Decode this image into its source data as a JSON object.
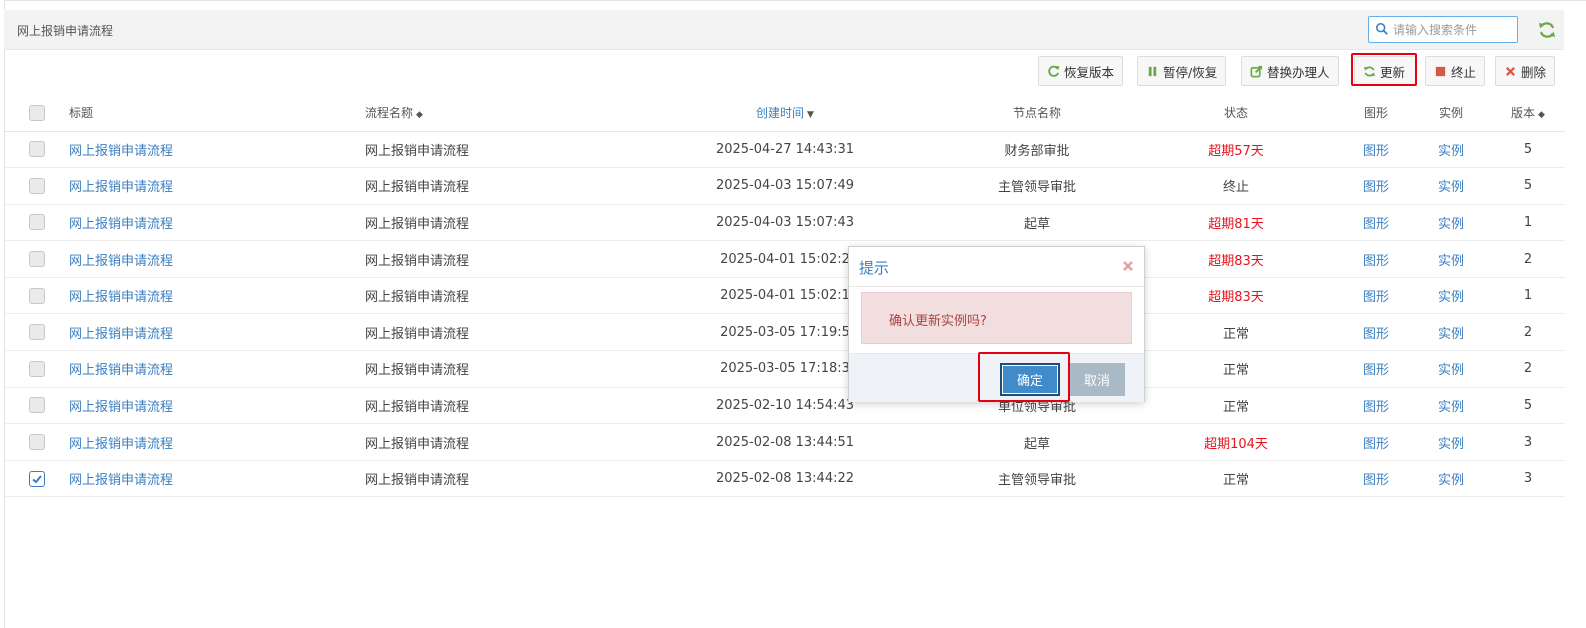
{
  "header": {
    "title": "网上报销申请流程"
  },
  "search": {
    "placeholder": "请输入搜索条件"
  },
  "toolbar": {
    "restore_label": "恢复版本",
    "pause_label": "暂停/恢复",
    "replace_label": "替换办理人",
    "update_label": "更新",
    "terminate_label": "终止",
    "delete_label": "删除"
  },
  "table": {
    "headers": {
      "title": "标题",
      "flow_name": "流程名称",
      "created": "创建时间",
      "node": "节点名称",
      "status": "状态",
      "graph": "图形",
      "instance": "实例",
      "version": "版本"
    },
    "rows": [
      {
        "title": "网上报销申请流程",
        "flow": "网上报销申请流程",
        "created": "2025-04-27 14:43:31",
        "node": "财务部审批",
        "status": "超期57天",
        "graph": "图形",
        "instance": "实例",
        "version": "5"
      },
      {
        "title": "网上报销申请流程",
        "flow": "网上报销申请流程",
        "created": "2025-04-03 15:07:49",
        "node": "主管领导审批",
        "status": "终止",
        "graph": "图形",
        "instance": "实例",
        "version": "5"
      },
      {
        "title": "网上报销申请流程",
        "flow": "网上报销申请流程",
        "created": "2025-04-03 15:07:43",
        "node": "起草",
        "status": "超期81天",
        "graph": "图形",
        "instance": "实例",
        "version": "1"
      },
      {
        "title": "网上报销申请流程",
        "flow": "网上报销申请流程",
        "created": "2025-04-01 15:02:2",
        "node": "",
        "status": "超期83天",
        "graph": "图形",
        "instance": "实例",
        "version": "2"
      },
      {
        "title": "网上报销申请流程",
        "flow": "网上报销申请流程",
        "created": "2025-04-01 15:02:1",
        "node": "",
        "status": "超期83天",
        "graph": "图形",
        "instance": "实例",
        "version": "1"
      },
      {
        "title": "网上报销申请流程",
        "flow": "网上报销申请流程",
        "created": "2025-03-05 17:19:5",
        "node": "",
        "status": "正常",
        "graph": "图形",
        "instance": "实例",
        "version": "2"
      },
      {
        "title": "网上报销申请流程",
        "flow": "网上报销申请流程",
        "created": "2025-03-05 17:18:3",
        "node": "",
        "status": "正常",
        "graph": "图形",
        "instance": "实例",
        "version": "2"
      },
      {
        "title": "网上报销申请流程",
        "flow": "网上报销申请流程",
        "created": "2025-02-10 14:54:43",
        "node": "单位领导审批",
        "status": "正常",
        "graph": "图形",
        "instance": "实例",
        "version": "5"
      },
      {
        "title": "网上报销申请流程",
        "flow": "网上报销申请流程",
        "created": "2025-02-08 13:44:51",
        "node": "起草",
        "status": "超期104天",
        "graph": "图形",
        "instance": "实例",
        "version": "3"
      },
      {
        "title": "网上报销申请流程",
        "flow": "网上报销申请流程",
        "created": "2025-02-08 13:44:22",
        "node": "主管领导审批",
        "status": "正常",
        "graph": "图形",
        "instance": "实例",
        "version": "3"
      }
    ],
    "checked_rows": [
      9
    ]
  },
  "dialog": {
    "title": "提示",
    "message": "确认更新实例吗?",
    "ok_label": "确定",
    "cancel_label": "取消"
  },
  "colors": {
    "link": "#3a7fc1",
    "overdue": "#e6141e",
    "highlight": "#e60012",
    "primary_button": "#428bca"
  }
}
